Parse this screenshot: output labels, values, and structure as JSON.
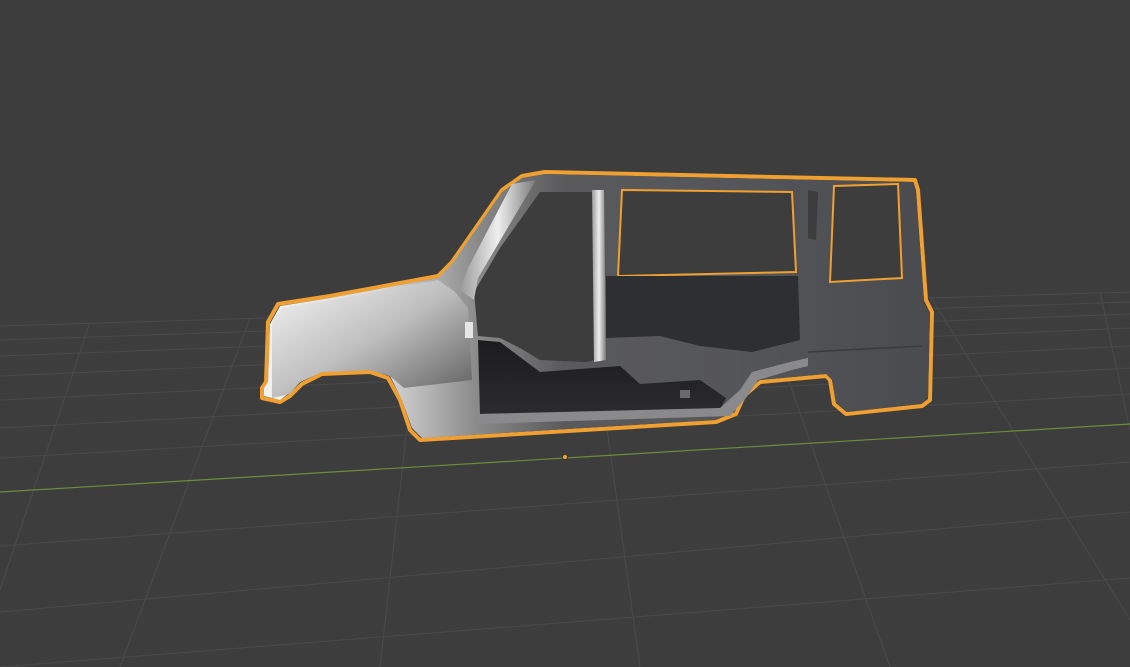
{
  "viewport": {
    "background": "#3d3d3d",
    "grid_color": "#4a4a4a",
    "x_axis_color": "#6b8e3a",
    "selection_outline_color": "#f0a030",
    "origin_color": "#f0a030",
    "grid_visible": true,
    "selected_object": {
      "icon": "car-body-mesh",
      "selected": true
    }
  }
}
